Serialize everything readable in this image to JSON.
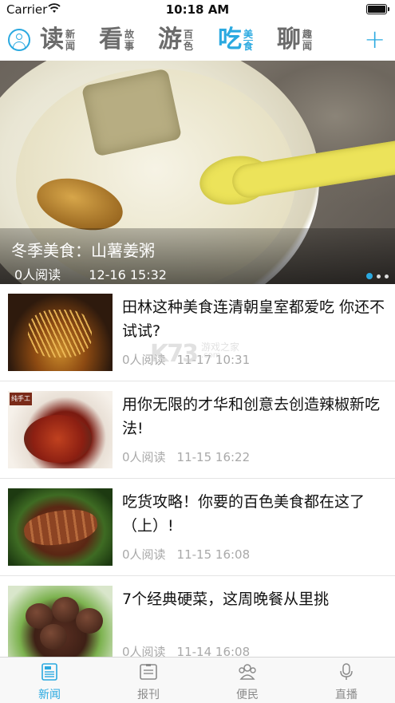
{
  "status_bar": {
    "carrier": "Carrier",
    "time": "10:18 AM"
  },
  "top_nav": {
    "tabs": [
      {
        "big": "读",
        "small_top": "新",
        "small_bottom": "闻",
        "active": false
      },
      {
        "big": "看",
        "small_top": "故",
        "small_bottom": "事",
        "active": false
      },
      {
        "big": "游",
        "small_top": "百",
        "small_bottom": "色",
        "active": false
      },
      {
        "big": "吃",
        "small_top": "美",
        "small_bottom": "食",
        "active": true
      },
      {
        "big": "聊",
        "small_top": "趣",
        "small_bottom": "闻",
        "active": false
      }
    ],
    "add_label": "+"
  },
  "hero": {
    "title": "冬季美食：山薯姜粥",
    "reads": "0人阅读",
    "time": "12-16 15:32",
    "page_count": 3,
    "active_page": 1
  },
  "news": [
    {
      "title": "田林这种美食连清朝皇室都爱吃 你还不试试?",
      "reads": "0人阅读",
      "time": "11-17 10:31"
    },
    {
      "title": "用你无限的才华和创意去创造辣椒新吃法!",
      "reads": "0人阅读",
      "time": "11-15 16:22"
    },
    {
      "title": "吃货攻略！你要的百色美食都在这了（上）!",
      "reads": "0人阅读",
      "time": "11-15 16:08"
    },
    {
      "title": "7个经典硬菜，这周晚餐从里挑",
      "reads": "0人阅读",
      "time": "11-14 16:08"
    }
  ],
  "thumb_labels": {
    "item2_tag": "纯手工"
  },
  "watermark": {
    "logo": "K73",
    "name": "游戏之家",
    "url": ".com"
  },
  "tab_bar": [
    {
      "label": "新闻",
      "icon": "newspaper-icon",
      "active": true
    },
    {
      "label": "报刊",
      "icon": "magazine-icon",
      "active": false
    },
    {
      "label": "便民",
      "icon": "people-icon",
      "active": false
    },
    {
      "label": "直播",
      "icon": "microphone-icon",
      "active": false
    }
  ],
  "colors": {
    "accent": "#2aa9e0",
    "inactive_tab": "#6b6b6b",
    "meta_text": "#a9a9a9"
  }
}
